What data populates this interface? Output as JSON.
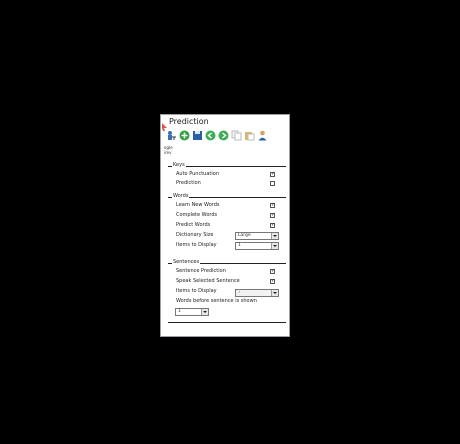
{
  "window": {
    "title": "Prediction"
  },
  "side_labels": [
    "ogle",
    "irev"
  ],
  "toolbar": {
    "icons": [
      "user-key-icon",
      "add-icon",
      "save-icon",
      "back-icon",
      "forward-icon",
      "copy-icon",
      "paste-icon",
      "user-icon"
    ]
  },
  "keys": {
    "legend": "Keys",
    "auto_punctuation": {
      "label": "Auto Punctuation",
      "checked": true
    },
    "prediction": {
      "label": "Prediction",
      "checked": false
    }
  },
  "words": {
    "legend": "Words",
    "learn_new_words": {
      "label": "Learn New Words",
      "checked": true
    },
    "complete_words": {
      "label": "Complete Words",
      "checked": true
    },
    "predict_words": {
      "label": "Predict Words",
      "checked": true
    },
    "dictionary_size": {
      "label": "Dictionary Size",
      "value": "Large"
    },
    "items_to_display": {
      "label": "Items to Display",
      "value": "1"
    }
  },
  "sentences": {
    "legend": "Sentences",
    "sentence_prediction": {
      "label": "Sentence Prediction",
      "checked": true
    },
    "speak_selected": {
      "label": "Speak Selected Sentence",
      "checked": true
    },
    "items_to_display": {
      "label": "Items to Display",
      "value": "1"
    },
    "words_before": {
      "label": "Words before sentence is shown",
      "value": "1"
    }
  }
}
